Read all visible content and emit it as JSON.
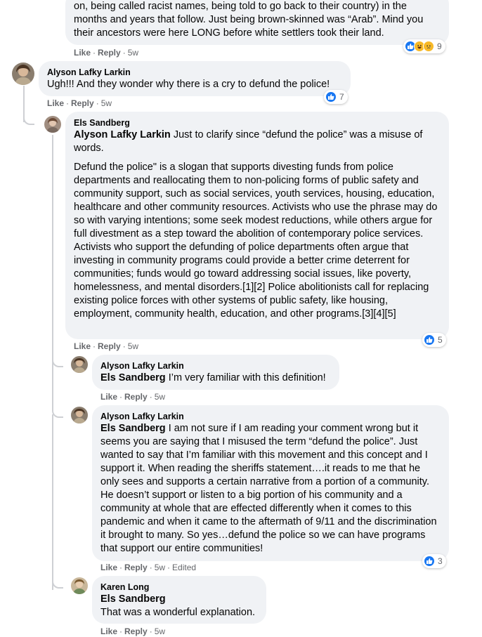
{
  "comments": [
    {
      "text_lines": [
        "on, being called racist names, being told to go back to their country) in the",
        "months and years that follow. Just being brown-skinned was “Arab”. Mind you",
        "their ancestors were here LONG before white settlers took their land."
      ],
      "like": "Like",
      "reply": "Reply",
      "time": "5w",
      "reactions": {
        "icons": [
          "like-icon",
          "haha-icon",
          "sad-icon"
        ],
        "count": "9"
      }
    },
    {
      "author": "Alyson Lafky Larkin",
      "text": "Ugh!!! And they wonder why there is a cry to defund the police!",
      "like": "Like",
      "reply": "Reply",
      "time": "5w",
      "reactions": {
        "icons": [
          "like-icon"
        ],
        "count": "7"
      }
    },
    {
      "author": "Els Sandberg",
      "tag": "Alyson Lafky Larkin",
      "text": " Just to clarify since “defund the police” was a misuse of words.",
      "paragraph": "Defund the police\" is a slogan that supports divesting funds from police departments and reallocating them to non-policing forms of public safety and community support, such as social services, youth services, housing, education, healthcare and other community resources. Activists who use the phrase may do so with varying intentions; some seek modest reductions, while others argue for full divestment as a step toward the abolition of contemporary police services. Activists who support the defunding of police departments often argue that investing in community programs could provide a better crime deterrent for communities; funds would go toward addressing social issues, like poverty, homelessness, and mental disorders.[1][2] Police abolitionists call for replacing existing police forces with other systems of public safety, like housing, employment, community health, education, and other programs.[3][4][5]",
      "like": "Like",
      "reply": "Reply",
      "time": "5w",
      "reactions": {
        "icons": [
          "like-icon"
        ],
        "count": "5"
      }
    },
    {
      "author": "Alyson Lafky Larkin",
      "tag": "Els Sandberg",
      "text": " I’m very familiar with this definition!",
      "like": "Like",
      "reply": "Reply",
      "time": "5w"
    },
    {
      "author": "Alyson Lafky Larkin",
      "tag": "Els Sandberg",
      "text": " I am not sure if I am reading your comment wrong but it seems you are saying that I misused the term “defund the police”. Just wanted to say that I’m familiar with this movement and this concept and I support it. When reading the sheriffs statement….it reads to me that he only sees and supports a certain narrative from a portion of a community. He doesn’t support or listen to a big portion of his community and a community at whole that are effected differently when it comes to this pandemic and when it came to the aftermath of 9/11 and the discrimination it brought to many. So yes…defund the police so we can have programs that support our entire communities!",
      "like": "Like",
      "reply": "Reply",
      "time": "5w",
      "edited": "Edited",
      "reactions": {
        "icons": [
          "like-icon"
        ],
        "count": "3"
      }
    },
    {
      "author": "Karen Long",
      "tag": "Els Sandberg",
      "text": "That was a wonderful explanation.",
      "like": "Like",
      "reply": "Reply",
      "time": "5w"
    }
  ],
  "colors": {
    "like_blue": "#1877f2",
    "bubble": "#f0f2f5",
    "meta": "#65676b"
  }
}
